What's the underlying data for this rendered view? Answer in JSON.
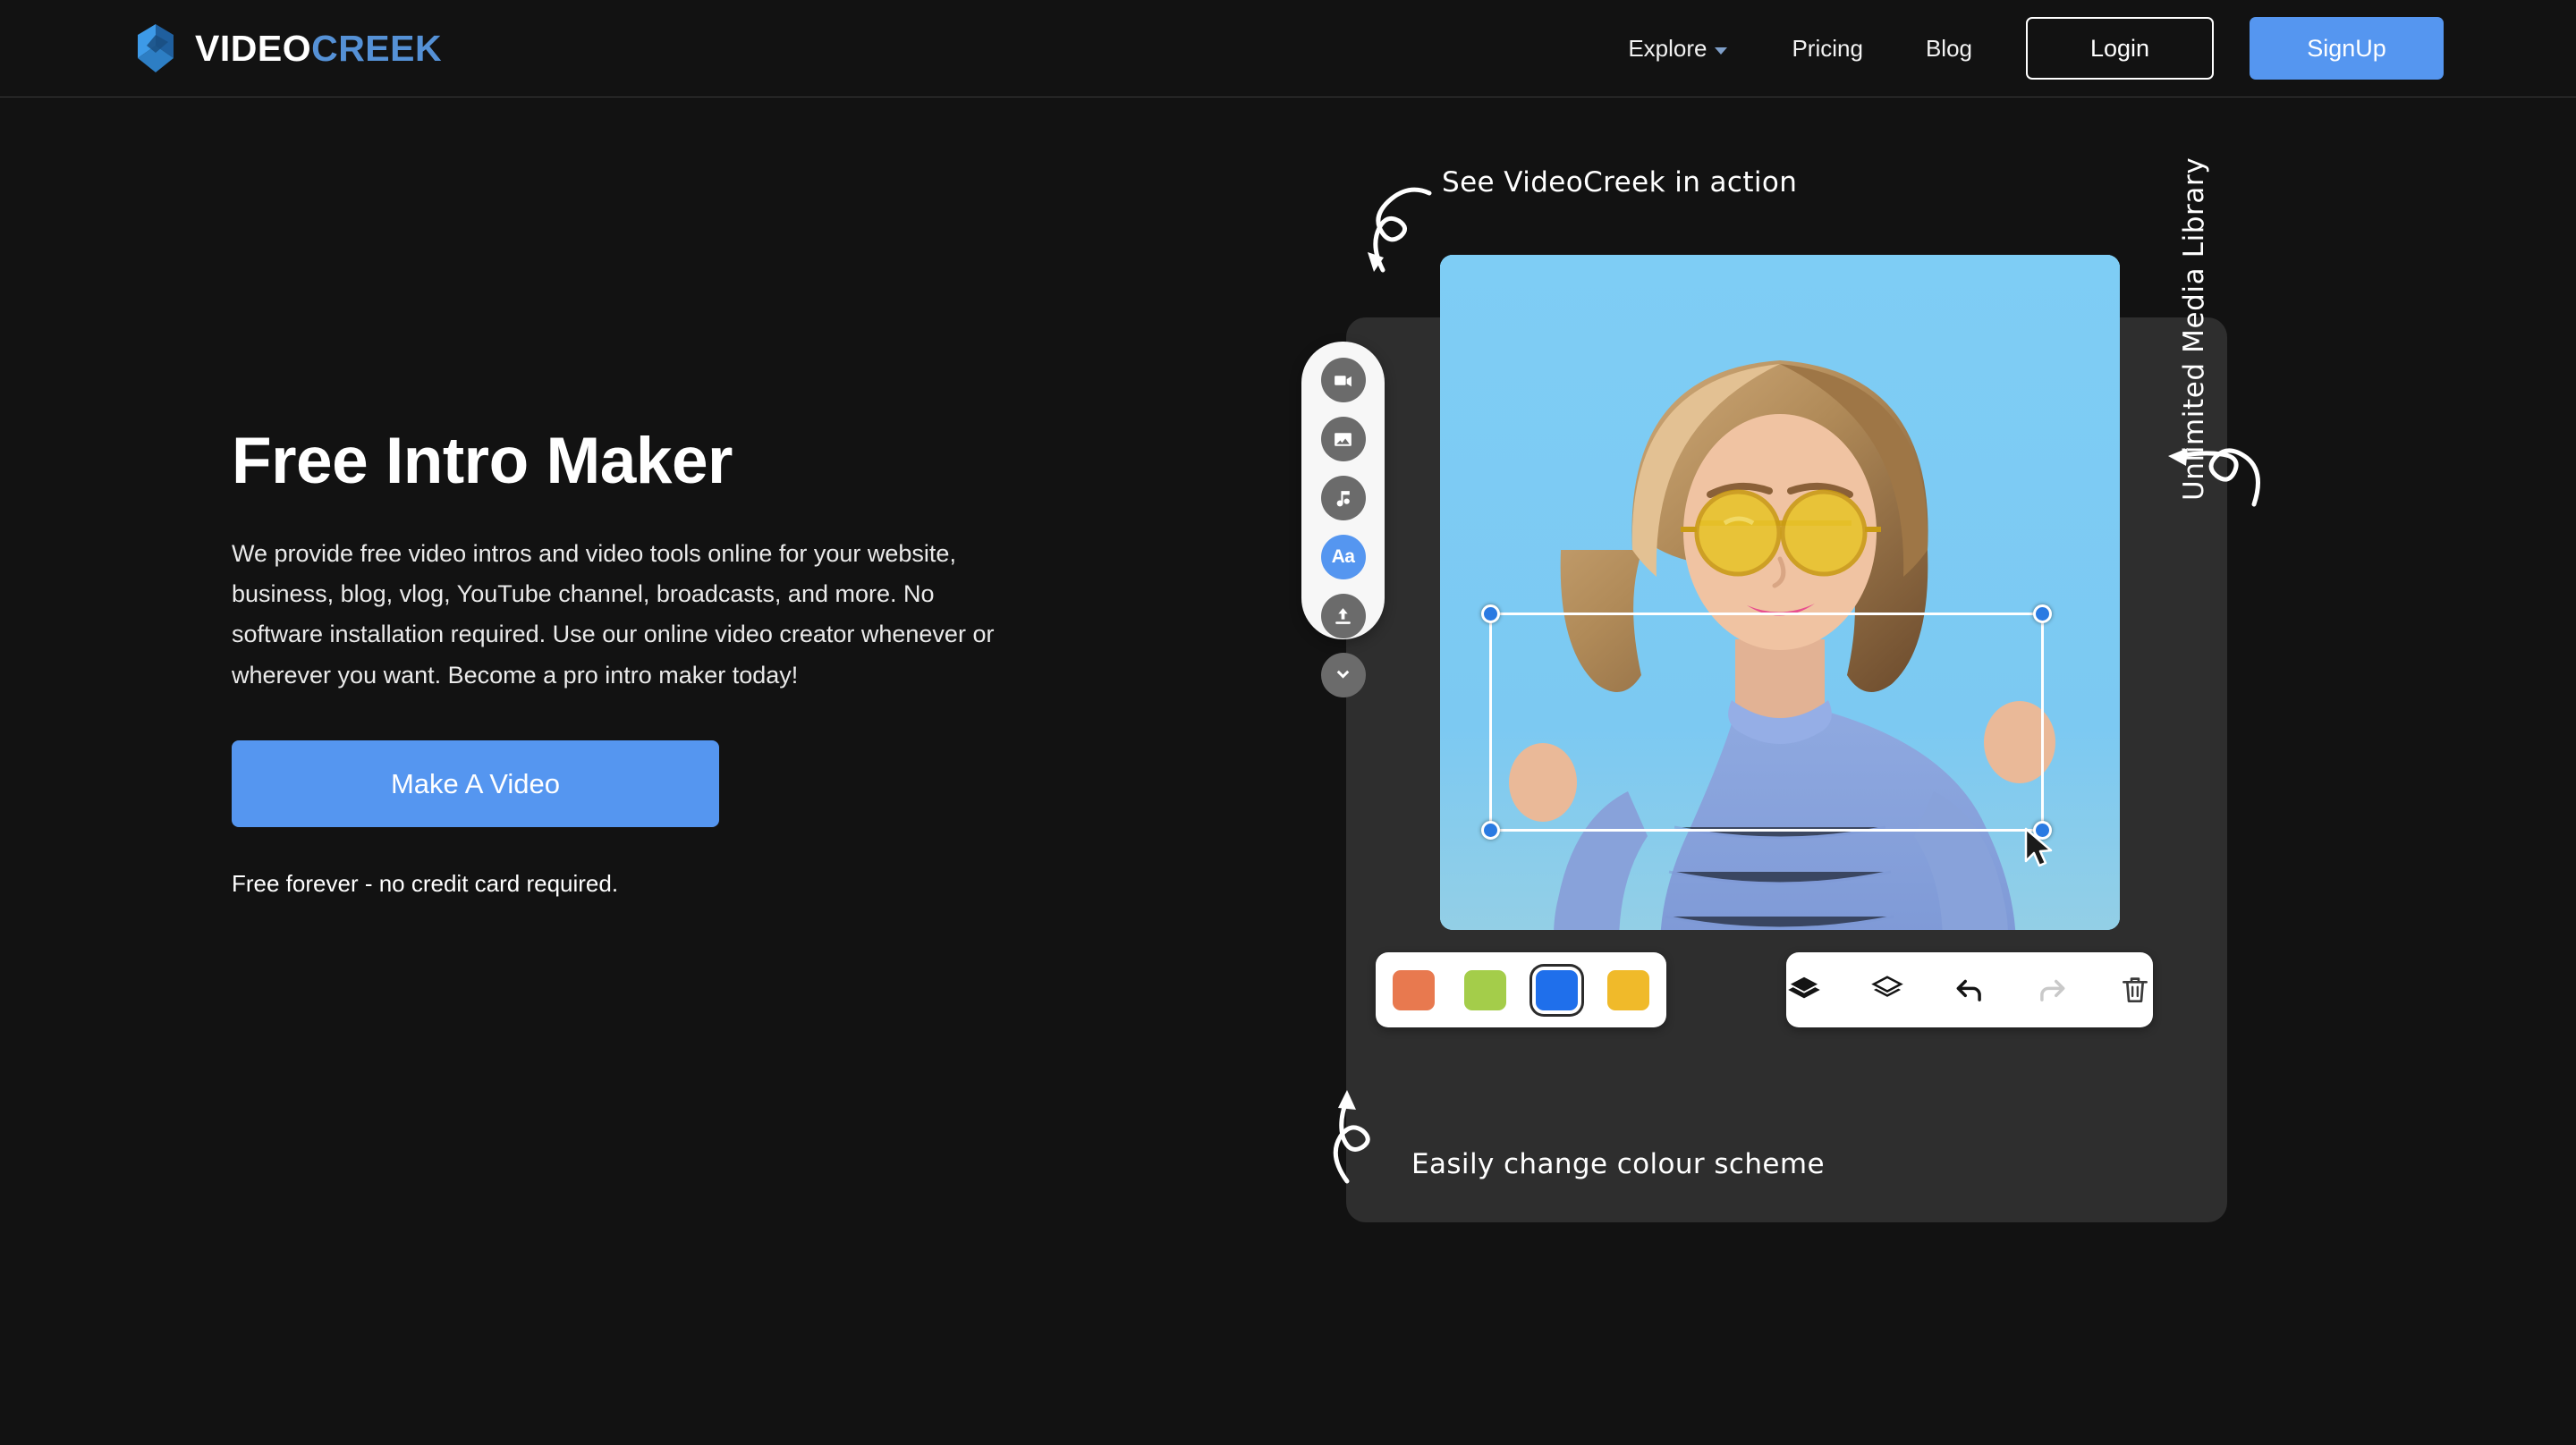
{
  "header": {
    "logo": {
      "part1": "VIDEO",
      "part2": "CREEK",
      "icon": "cube-logo-icon"
    },
    "nav": {
      "explore": "Explore",
      "pricing": "Pricing",
      "blog": "Blog",
      "login": "Login",
      "signup": "SignUp"
    }
  },
  "hero": {
    "title": "Free Intro Maker",
    "paragraph": "We provide free video intros and video tools online for your website, business, blog, vlog, YouTube channel, broadcasts, and more. No software installation required. Use our online video creator whenever or wherever you want. Become a pro intro maker today!",
    "cta": "Make A Video",
    "note": "Free forever - no credit card required."
  },
  "annotations": {
    "top": "See VideoCreek in action",
    "right": "Unlimited Media Library",
    "bottom": "Easily change colour scheme"
  },
  "editor": {
    "tools": [
      {
        "name": "video-tool",
        "icon": "video-camera-icon",
        "active": false
      },
      {
        "name": "image-tool",
        "icon": "image-icon",
        "active": false
      },
      {
        "name": "music-tool",
        "icon": "music-note-icon",
        "active": false
      },
      {
        "name": "text-tool",
        "icon": "text-aa-icon",
        "label": "Aa",
        "active": true
      },
      {
        "name": "upload-tool",
        "icon": "upload-icon",
        "active": false
      },
      {
        "name": "more-tool",
        "icon": "chevron-down-icon",
        "active": false
      }
    ],
    "colors": [
      {
        "name": "salmon",
        "hex": "#E8794F",
        "selected": false
      },
      {
        "name": "green",
        "hex": "#A4CD4A",
        "selected": false
      },
      {
        "name": "blue",
        "hex": "#1F6FEB",
        "selected": true
      },
      {
        "name": "gold",
        "hex": "#F0BA2A",
        "selected": false
      }
    ],
    "actions": [
      {
        "name": "bring-to-front",
        "icon": "layers-front-icon",
        "enabled": true
      },
      {
        "name": "send-to-back",
        "icon": "layers-back-icon",
        "enabled": true
      },
      {
        "name": "undo",
        "icon": "undo-arrow-icon",
        "enabled": true
      },
      {
        "name": "redo",
        "icon": "redo-arrow-icon",
        "enabled": false
      },
      {
        "name": "delete",
        "icon": "trash-icon",
        "enabled": true
      }
    ],
    "canvas": {
      "subject": "woman-with-yellow-sunglasses",
      "background_hex": "#7CC9F2",
      "selection_handles": 4
    }
  },
  "theme": {
    "background": "#121212",
    "accent": "#5596F0",
    "logo_accent": "#5591D6",
    "panel": "#2E2E2E"
  }
}
